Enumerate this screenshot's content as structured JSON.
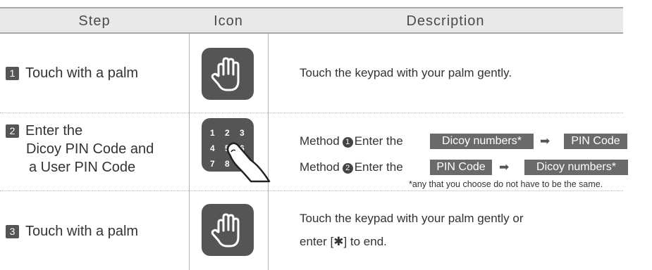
{
  "header": {
    "step": "Step",
    "icon": "Icon",
    "description": "Description"
  },
  "rows": [
    {
      "number": "1",
      "step_label": "Touch with a palm",
      "icon": "palm-icon",
      "description": "Touch the keypad with your palm gently."
    },
    {
      "number": "2",
      "step_lines": [
        "Enter the",
        "Dicoy PIN Code and",
        "a User PIN Code"
      ],
      "icon": "keypad-icon",
      "keypad_digits": [
        "1",
        "2",
        "3",
        "4",
        "5",
        "6",
        "7",
        "8"
      ],
      "methods": [
        {
          "label": "Method",
          "num": "1",
          "text": "Enter the",
          "first": "Dicoy numbers*",
          "arrow": "➡",
          "second": "PIN Code"
        },
        {
          "label": "Method",
          "num": "2",
          "text": "Enter the",
          "first": "PIN Code",
          "arrow": "➡",
          "second": "Dicoy numbers*"
        }
      ],
      "note": "*any that you choose do not have to be the same."
    },
    {
      "number": "3",
      "step_label": "Touch with a palm",
      "icon": "palm-icon",
      "description_lines": [
        "Touch the keypad with your palm gently or",
        "enter [✱] to end."
      ]
    }
  ],
  "colors": {
    "header_bg": "#e9e9e9",
    "icon_bg": "#555555",
    "tag_bg": "#6a6a6a"
  }
}
